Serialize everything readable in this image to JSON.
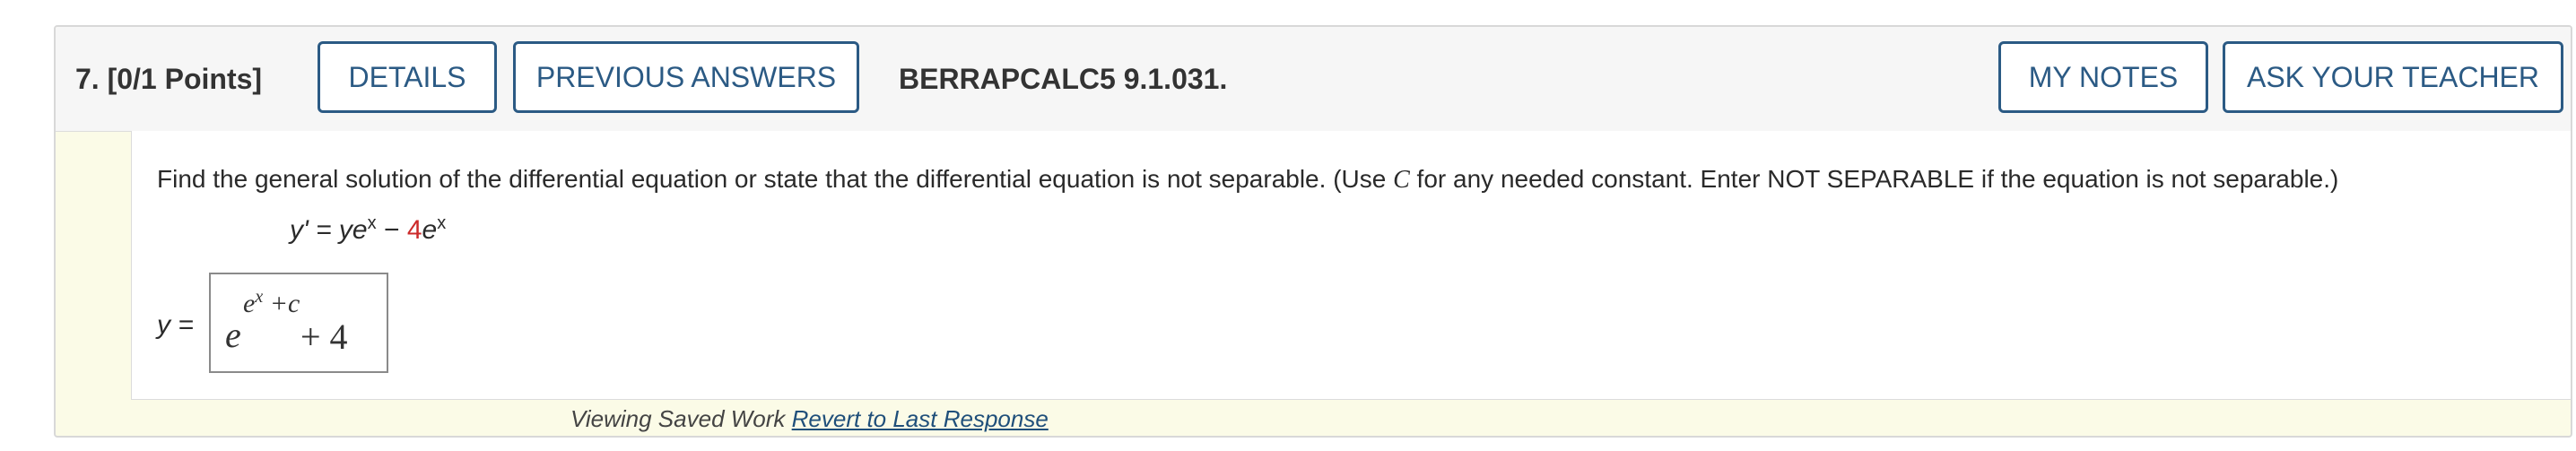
{
  "question": {
    "number_label": "7.",
    "points_label": "[0/1 Points]",
    "reference": "BERRAPCALC5 9.1.031."
  },
  "buttons": {
    "details": "DETAILS",
    "previous_answers": "PREVIOUS ANSWERS",
    "my_notes": "MY NOTES",
    "ask_teacher": "ASK YOUR TEACHER"
  },
  "prompt": {
    "text_before": "Find the general solution of the differential equation or state that the differential equation is not separable. (Use ",
    "constant": "C",
    "text_after": " for any needed constant. Enter NOT SEPARABLE if the equation is not separable.)"
  },
  "equation": {
    "lhs": "y' = ",
    "term1_y": "y",
    "term1_e": "e",
    "term1_exp": "x",
    "minus": " − ",
    "coefficient": "4",
    "term2_e": "e",
    "term2_exp": "x"
  },
  "answer": {
    "label": "y =",
    "base": "e",
    "exponent_e": "e",
    "exponent_x": "x",
    "exponent_tail": " +c",
    "tail": " + 4"
  },
  "footer": {
    "viewing_text": "Viewing Saved Work ",
    "revert_link": "Revert to Last Response"
  },
  "colors": {
    "button_border": "#2b5a84",
    "highlight_red": "#cc2a2a",
    "footer_background": "#fbfbe7"
  }
}
